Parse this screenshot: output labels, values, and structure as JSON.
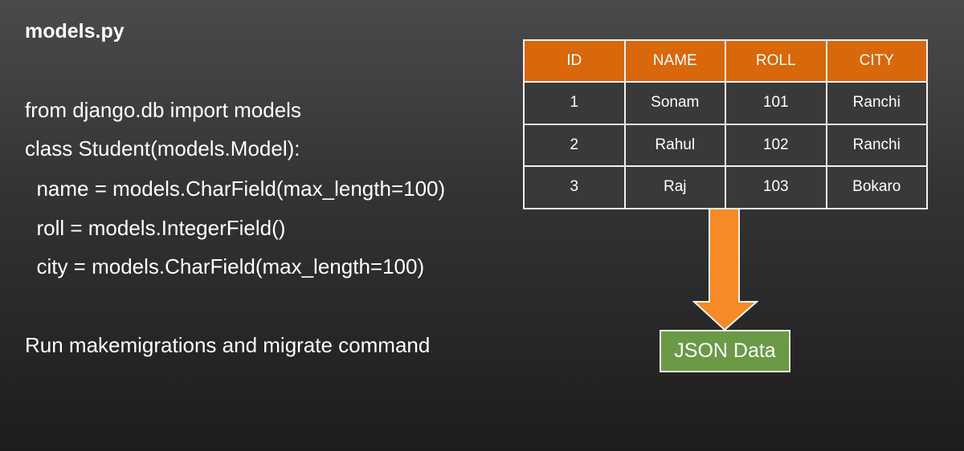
{
  "title": "models.py",
  "code": [
    "from django.db import models",
    "class Student(models.Model):",
    "  name = models.CharField(max_length=100)",
    "  roll = models.IntegerField()",
    "  city = models.CharField(max_length=100)"
  ],
  "note": "Run makemigrations and migrate command",
  "table": {
    "headers": [
      "ID",
      "NAME",
      "ROLL",
      "CITY"
    ],
    "rows": [
      [
        "1",
        "Sonam",
        "101",
        "Ranchi"
      ],
      [
        "2",
        "Rahul",
        "102",
        "Ranchi"
      ],
      [
        "3",
        "Raj",
        "103",
        "Bokaro"
      ]
    ]
  },
  "output_label": "JSON Data",
  "colors": {
    "header": "#d9670b",
    "arrow": "#f58a27",
    "json_box": "#6a9a46"
  }
}
